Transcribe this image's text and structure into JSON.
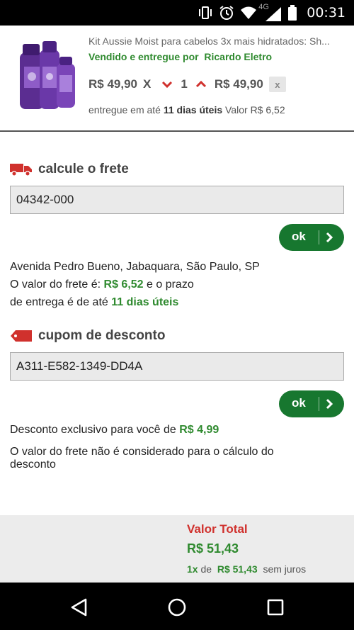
{
  "status_bar": {
    "time": "00:31",
    "network": "4G",
    "icons": [
      "vibrate-icon",
      "alarm-icon",
      "wifi-icon",
      "signal-icon",
      "battery-icon"
    ]
  },
  "cart_item": {
    "title": "Kit Aussie Moist para cabelos 3x mais hidratados: Sh...",
    "seller_prefix": "Vendido e entregue por",
    "seller_name": "Ricardo Eletro",
    "unit_price": "R$ 49,90",
    "times": "X",
    "quantity": "1",
    "line_total": "R$ 49,90",
    "remove": "x",
    "delivery_prefix": "entregue em até",
    "delivery_days": "11 dias úteis",
    "delivery_value_label": "Valor R$ 6,52"
  },
  "shipping": {
    "heading": "calcule o frete",
    "zip_value": "04342-000",
    "ok_label": "ok",
    "address": "Avenida Pedro Bueno, Jabaquara, São Paulo, SP",
    "freight_prefix": "O valor do frete é:",
    "freight_value": "R$ 6,52",
    "freight_suffix": "e o prazo",
    "deadline_prefix": "de entrega é de até",
    "deadline_value": "11 dias úteis"
  },
  "coupon": {
    "heading": "cupom de desconto",
    "code_value": "A311-E582-1349-DD4A",
    "ok_label": "ok",
    "discount_prefix": "Desconto exclusivo para você de",
    "discount_value": "R$ 4,99",
    "note_line1": "O valor do frete não é considerado para o cálculo do",
    "note_line2": "desconto"
  },
  "totals": {
    "label": "Valor Total",
    "value": "R$ 51,43",
    "installments_count": "1x",
    "installments_de": "de",
    "installments_value": "R$ 51,43",
    "installments_suffix": "sem juros"
  },
  "colors": {
    "green": "#2f8a2f",
    "ok_button": "#17772f",
    "accent_red": "#d0312d"
  }
}
